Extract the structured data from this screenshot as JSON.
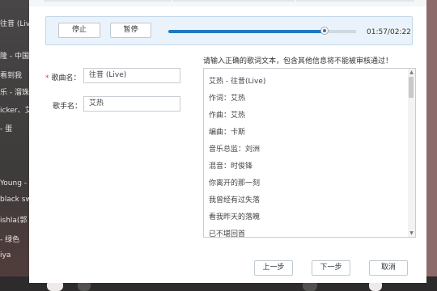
{
  "background": {
    "items": [
      "往昔 (Live",
      "隆 - 中国",
      "看到我",
      "乐 - 溜珠树",
      "icker、艾",
      "- 蛋",
      "Young -",
      "black sw",
      "ishla(郭",
      "- 绿色",
      "iya"
    ]
  },
  "player": {
    "stop_label": "停止",
    "pause_label": "暂停",
    "progress_fraction": 0.83,
    "time": "01:57/02:22"
  },
  "form": {
    "required_mark": "*",
    "song_label": "歌曲名：",
    "song_value": "往昔 (Live)",
    "singer_label": "歌手名：",
    "singer_value": "艾热",
    "hint": "请输入正确的歌词文本，包含其他信息将不能被审核通过！"
  },
  "lyrics": [
    "艾热 - 往昔(Live)",
    "作词：艾热",
    "作曲：艾热",
    "编曲：卡斯",
    "音乐总监：刘洲",
    "混音：时俊锋",
    "你离开的那一刻",
    "我曾经有过失落",
    "看我昨天的落魄",
    "已不堪回首"
  ],
  "footer": {
    "prev_label": "上一步",
    "next_label": "下一步",
    "cancel_label": "取消"
  },
  "icons": {
    "scroll_up": "scroll-up-icon",
    "scroll_down": "scroll-down-icon"
  },
  "colors": {
    "accent": "#1f78c1",
    "required": "#e0312d",
    "player_bg": "#eaf3fb"
  }
}
